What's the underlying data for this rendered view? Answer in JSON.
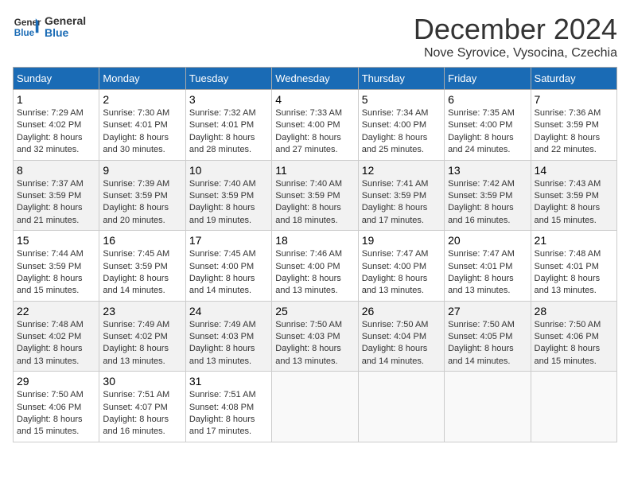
{
  "logo": {
    "line1": "General",
    "line2": "Blue"
  },
  "title": "December 2024",
  "location": "Nove Syrovice, Vysocina, Czechia",
  "weekdays": [
    "Sunday",
    "Monday",
    "Tuesday",
    "Wednesday",
    "Thursday",
    "Friday",
    "Saturday"
  ],
  "weeks": [
    [
      {
        "day": "1",
        "info": "Sunrise: 7:29 AM\nSunset: 4:02 PM\nDaylight: 8 hours\nand 32 minutes."
      },
      {
        "day": "2",
        "info": "Sunrise: 7:30 AM\nSunset: 4:01 PM\nDaylight: 8 hours\nand 30 minutes."
      },
      {
        "day": "3",
        "info": "Sunrise: 7:32 AM\nSunset: 4:01 PM\nDaylight: 8 hours\nand 28 minutes."
      },
      {
        "day": "4",
        "info": "Sunrise: 7:33 AM\nSunset: 4:00 PM\nDaylight: 8 hours\nand 27 minutes."
      },
      {
        "day": "5",
        "info": "Sunrise: 7:34 AM\nSunset: 4:00 PM\nDaylight: 8 hours\nand 25 minutes."
      },
      {
        "day": "6",
        "info": "Sunrise: 7:35 AM\nSunset: 4:00 PM\nDaylight: 8 hours\nand 24 minutes."
      },
      {
        "day": "7",
        "info": "Sunrise: 7:36 AM\nSunset: 3:59 PM\nDaylight: 8 hours\nand 22 minutes."
      }
    ],
    [
      {
        "day": "8",
        "info": "Sunrise: 7:37 AM\nSunset: 3:59 PM\nDaylight: 8 hours\nand 21 minutes."
      },
      {
        "day": "9",
        "info": "Sunrise: 7:39 AM\nSunset: 3:59 PM\nDaylight: 8 hours\nand 20 minutes."
      },
      {
        "day": "10",
        "info": "Sunrise: 7:40 AM\nSunset: 3:59 PM\nDaylight: 8 hours\nand 19 minutes."
      },
      {
        "day": "11",
        "info": "Sunrise: 7:40 AM\nSunset: 3:59 PM\nDaylight: 8 hours\nand 18 minutes."
      },
      {
        "day": "12",
        "info": "Sunrise: 7:41 AM\nSunset: 3:59 PM\nDaylight: 8 hours\nand 17 minutes."
      },
      {
        "day": "13",
        "info": "Sunrise: 7:42 AM\nSunset: 3:59 PM\nDaylight: 8 hours\nand 16 minutes."
      },
      {
        "day": "14",
        "info": "Sunrise: 7:43 AM\nSunset: 3:59 PM\nDaylight: 8 hours\nand 15 minutes."
      }
    ],
    [
      {
        "day": "15",
        "info": "Sunrise: 7:44 AM\nSunset: 3:59 PM\nDaylight: 8 hours\nand 15 minutes."
      },
      {
        "day": "16",
        "info": "Sunrise: 7:45 AM\nSunset: 3:59 PM\nDaylight: 8 hours\nand 14 minutes."
      },
      {
        "day": "17",
        "info": "Sunrise: 7:45 AM\nSunset: 4:00 PM\nDaylight: 8 hours\nand 14 minutes."
      },
      {
        "day": "18",
        "info": "Sunrise: 7:46 AM\nSunset: 4:00 PM\nDaylight: 8 hours\nand 13 minutes."
      },
      {
        "day": "19",
        "info": "Sunrise: 7:47 AM\nSunset: 4:00 PM\nDaylight: 8 hours\nand 13 minutes."
      },
      {
        "day": "20",
        "info": "Sunrise: 7:47 AM\nSunset: 4:01 PM\nDaylight: 8 hours\nand 13 minutes."
      },
      {
        "day": "21",
        "info": "Sunrise: 7:48 AM\nSunset: 4:01 PM\nDaylight: 8 hours\nand 13 minutes."
      }
    ],
    [
      {
        "day": "22",
        "info": "Sunrise: 7:48 AM\nSunset: 4:02 PM\nDaylight: 8 hours\nand 13 minutes."
      },
      {
        "day": "23",
        "info": "Sunrise: 7:49 AM\nSunset: 4:02 PM\nDaylight: 8 hours\nand 13 minutes."
      },
      {
        "day": "24",
        "info": "Sunrise: 7:49 AM\nSunset: 4:03 PM\nDaylight: 8 hours\nand 13 minutes."
      },
      {
        "day": "25",
        "info": "Sunrise: 7:50 AM\nSunset: 4:03 PM\nDaylight: 8 hours\nand 13 minutes."
      },
      {
        "day": "26",
        "info": "Sunrise: 7:50 AM\nSunset: 4:04 PM\nDaylight: 8 hours\nand 14 minutes."
      },
      {
        "day": "27",
        "info": "Sunrise: 7:50 AM\nSunset: 4:05 PM\nDaylight: 8 hours\nand 14 minutes."
      },
      {
        "day": "28",
        "info": "Sunrise: 7:50 AM\nSunset: 4:06 PM\nDaylight: 8 hours\nand 15 minutes."
      }
    ],
    [
      {
        "day": "29",
        "info": "Sunrise: 7:50 AM\nSunset: 4:06 PM\nDaylight: 8 hours\nand 15 minutes."
      },
      {
        "day": "30",
        "info": "Sunrise: 7:51 AM\nSunset: 4:07 PM\nDaylight: 8 hours\nand 16 minutes."
      },
      {
        "day": "31",
        "info": "Sunrise: 7:51 AM\nSunset: 4:08 PM\nDaylight: 8 hours\nand 17 minutes."
      },
      {
        "day": "",
        "info": ""
      },
      {
        "day": "",
        "info": ""
      },
      {
        "day": "",
        "info": ""
      },
      {
        "day": "",
        "info": ""
      }
    ]
  ]
}
